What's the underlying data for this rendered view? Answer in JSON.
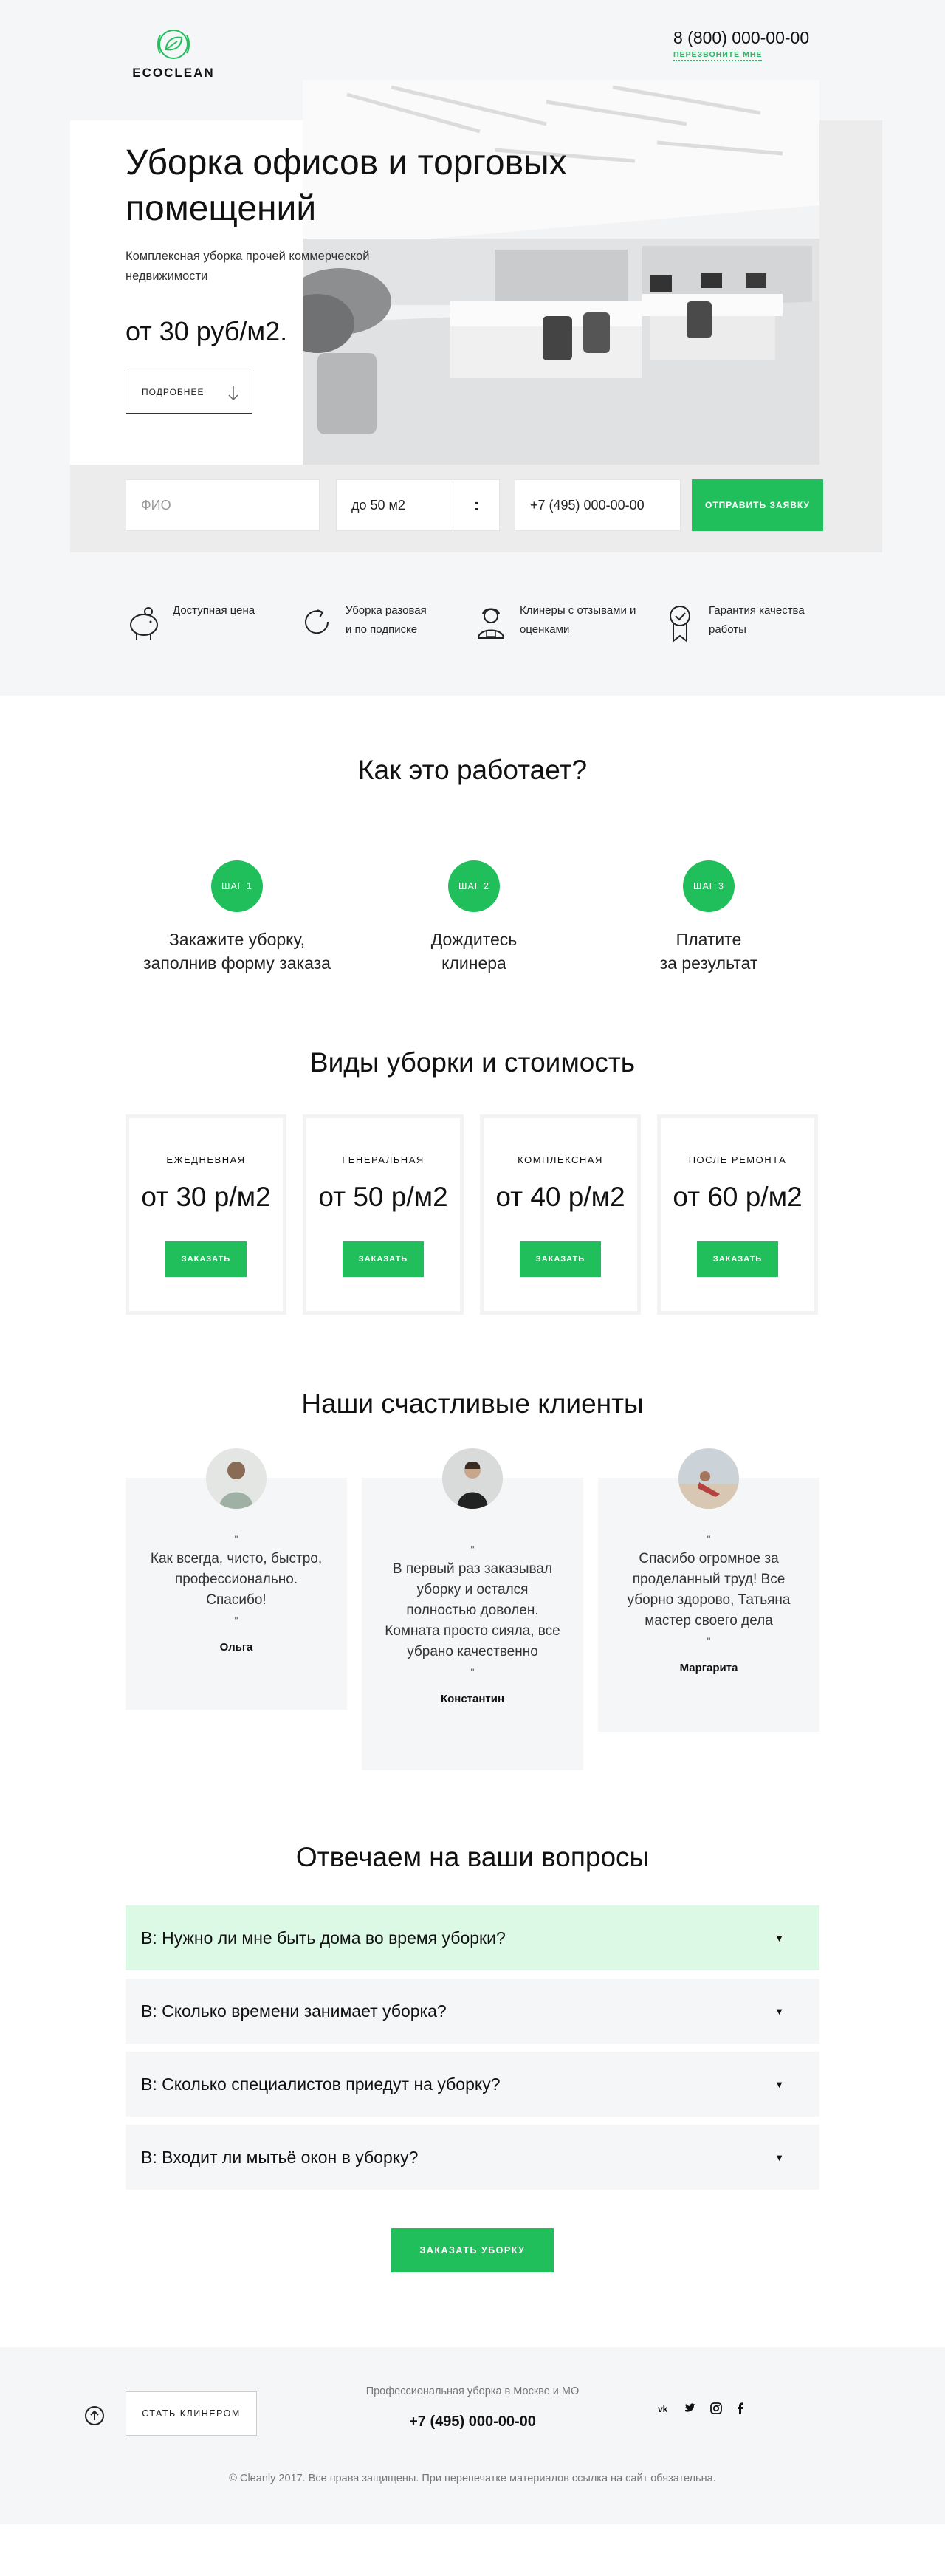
{
  "header": {
    "logo_text": "ECOCLEAN",
    "phone": "8 (800) 000-00-00",
    "callback_label": "ПЕРЕЗВОНИТЕ МНЕ"
  },
  "hero": {
    "title_line1": "Уборка офисов и торговых",
    "title_line2": "помещений",
    "subtitle_line1": "Комплексная уборка прочей коммерческой",
    "subtitle_line2": "недвижимости",
    "price": "от 30 руб/м2.",
    "more_label": "ПОДРОБНЕЕ"
  },
  "form": {
    "name_placeholder": "ФИО",
    "area_value": "до 50 м2",
    "phone_value": "+7 (495) 000-00-00",
    "submit_label": "ОТПРАВИТЬ ЗАЯВКУ"
  },
  "features": [
    {
      "icon": "piggy-bank-icon",
      "line1": "Доступная цена",
      "line2": ""
    },
    {
      "icon": "refresh-icon",
      "line1": "Уборка разовая",
      "line2": "и по подписке"
    },
    {
      "icon": "cleaner-icon",
      "line1": "Клинеры с отзывами и",
      "line2": "оценками"
    },
    {
      "icon": "quality-badge-icon",
      "line1": "Гарантия качества",
      "line2": "работы"
    }
  ],
  "how": {
    "title": "Как это работает?",
    "steps": [
      {
        "badge": "ШАГ 1",
        "line1": "Закажите уборку,",
        "line2": "заполнив форму заказа"
      },
      {
        "badge": "ШАГ 2",
        "line1": "Дождитесь",
        "line2": "клинера"
      },
      {
        "badge": "ШАГ 3",
        "line1": "Платите",
        "line2": "за результат"
      }
    ]
  },
  "services": {
    "title": "Виды уборки и стоимость",
    "items": [
      {
        "name": "ЕЖЕДНЕВНАЯ",
        "price": "от 30 р/м2",
        "button": "ЗАКАЗАТЬ"
      },
      {
        "name": "ГЕНЕРАЛЬНАЯ",
        "price": "от 50 р/м2",
        "button": "ЗАКАЗАТЬ"
      },
      {
        "name": "КОМПЛЕКСНАЯ",
        "price": "от 40 р/м2",
        "button": "ЗАКАЗАТЬ"
      },
      {
        "name": "ПОСЛЕ РЕМОНТА",
        "price": "от 60 р/м2",
        "button": "ЗАКАЗАТЬ"
      }
    ]
  },
  "reviews": {
    "title": "Наши счастливые клиенты",
    "items": [
      {
        "lines": [
          "Как всегда, чисто, быстро,",
          "профессионально.",
          "Спасибо!"
        ],
        "name": "Ольга"
      },
      {
        "lines": [
          "В первый раз заказывал",
          "уборку и остался",
          "полностью доволен.",
          "Комната просто сияла, все",
          "убрано качественно"
        ],
        "name": "Константин"
      },
      {
        "lines": [
          "Спасибо огромное за",
          "проделанный труд! Все",
          "уборно здорово, Татьяна",
          "мастер своего дела"
        ],
        "name": "Маргарита"
      }
    ]
  },
  "faq": {
    "title": "Отвечаем на ваши вопросы",
    "items": [
      "В: Нужно ли мне быть дома во время уборки?",
      "В: Сколько времени занимает уборка?",
      "В: Сколько специалистов приедут на уборку?",
      "В: Входит ли мытьё окон в уборку?"
    ],
    "order_label": "ЗАКАЗАТЬ УБОРКУ"
  },
  "footer": {
    "cleaner_label": "СТАТЬ КЛИНЕРОМ",
    "subtitle": "Профессиональная уборка в Москве и МО",
    "phone": "+7 (495) 000-00-00",
    "copyright": "© Cleanly 2017. Все права защищены. При перепечатке материалов ссылка на сайт обязательна.",
    "socials": [
      "vk-icon",
      "twitter-icon",
      "instagram-icon",
      "facebook-icon"
    ]
  },
  "colors": {
    "accent": "#21bf5b",
    "light_bg": "#f5f6f7",
    "faq_open_bg": "#dcf9e6"
  }
}
